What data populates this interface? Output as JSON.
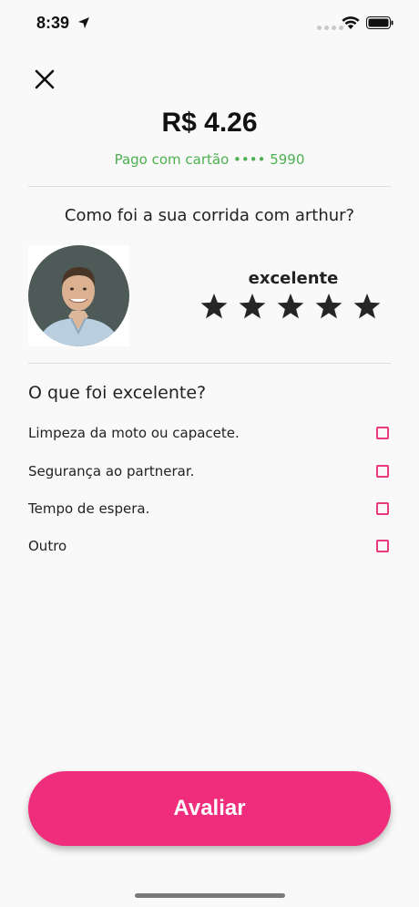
{
  "status_bar": {
    "time": "8:39",
    "icons": [
      "location-arrow-icon",
      "signal-dots-icon",
      "wifi-icon",
      "battery-icon"
    ]
  },
  "header": {
    "close_icon": "close-icon"
  },
  "payment": {
    "amount": "R$ 4.26",
    "method": "Pago com cartão •••• 5990"
  },
  "ride": {
    "question": "Como foi a sua corrida com arthur?",
    "rating_label": "excelente",
    "rating_value": 5,
    "rating_max": 5
  },
  "feedback": {
    "title": "O que foi excelente?",
    "options": [
      {
        "label": "Limpeza da moto ou capacete.",
        "checked": false
      },
      {
        "label": "Segurança ao partnerar.",
        "checked": false
      },
      {
        "label": "Tempo de espera.",
        "checked": false
      },
      {
        "label": "Outro",
        "checked": false
      }
    ]
  },
  "actions": {
    "submit_label": "Avaliar"
  },
  "colors": {
    "accent": "#f02c7d",
    "checkbox_border": "#e83c7e",
    "paid_text": "#4caf50",
    "background": "#f9f9f9"
  }
}
